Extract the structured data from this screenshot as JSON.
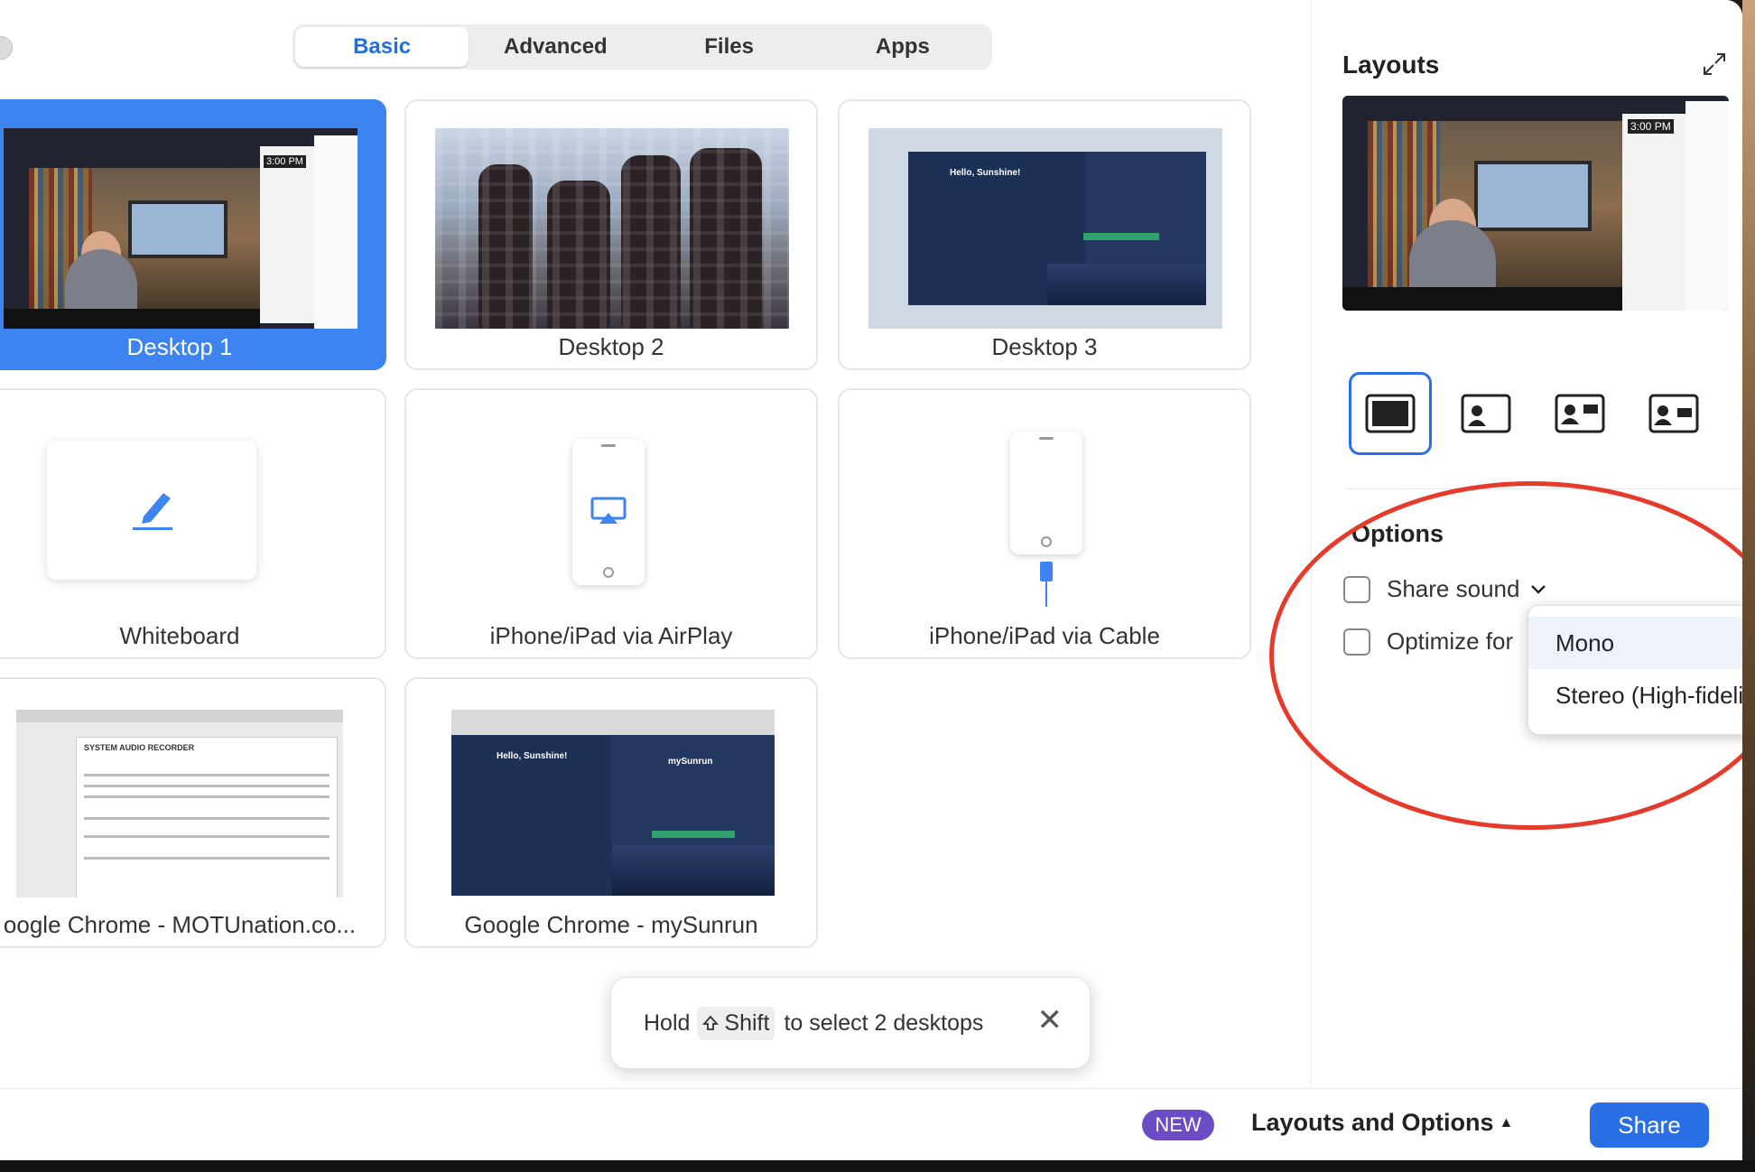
{
  "tabs": [
    {
      "label": "Basic"
    },
    {
      "label": "Advanced"
    },
    {
      "label": "Files"
    },
    {
      "label": "Apps"
    }
  ],
  "tiles": [
    {
      "label": "Desktop 1"
    },
    {
      "label": "Desktop 2"
    },
    {
      "label": "Desktop 3"
    },
    {
      "label": "Whiteboard"
    },
    {
      "label": "iPhone/iPad via AirPlay"
    },
    {
      "label": "iPhone/iPad via Cable"
    },
    {
      "label": "oogle Chrome - MOTUnation.co..."
    },
    {
      "label": "Google Chrome - mySunrun"
    }
  ],
  "thumbnail_text": {
    "clock": "3:00 PM",
    "sunshine": "Hello, Sunshine!",
    "mysunrun": "mySunrun",
    "motu_heading": "SYSTEM AUDIO RECORDER"
  },
  "toast": {
    "hold": "Hold",
    "key": "Shift",
    "rest": "to select 2 desktops"
  },
  "bottom": {
    "badge": "NEW",
    "layouts_toggle": "Layouts and Options",
    "share": "Share"
  },
  "panel": {
    "layouts_title": "Layouts",
    "options_title": "Options",
    "share_sound": "Share sound",
    "optimize_for": "Optimize for",
    "dropdown": [
      "Mono",
      "Stereo (High-fideli"
    ]
  },
  "colors": {
    "accent": "#2b6fe6",
    "selected_tile": "#3d84f0",
    "badge": "#6b4cc4",
    "annotation": "#e53b2c"
  }
}
